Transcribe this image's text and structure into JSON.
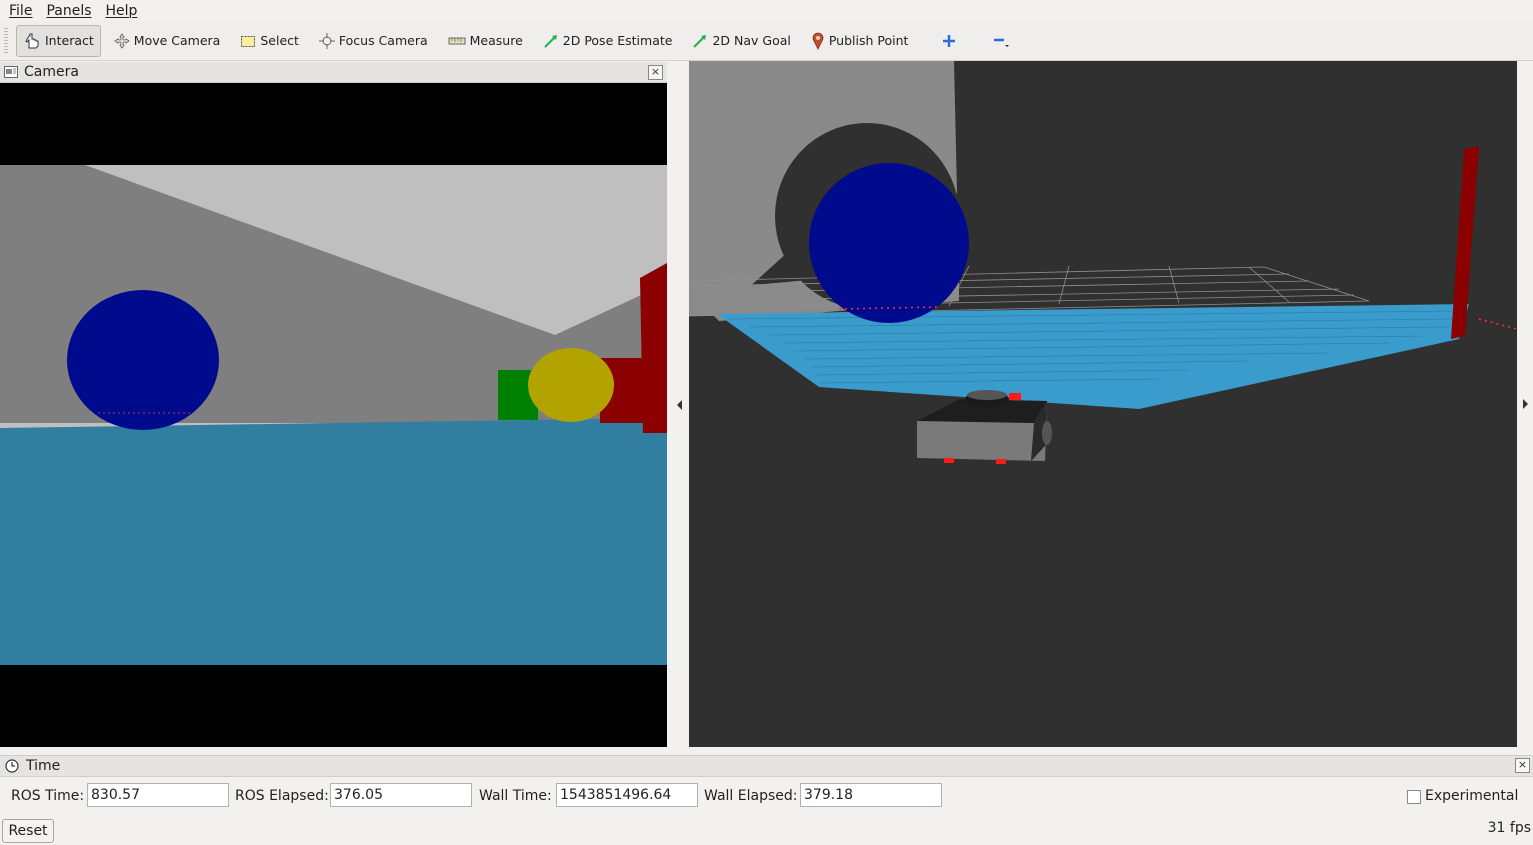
{
  "menu": {
    "file": "File",
    "panels": "Panels",
    "help": "Help"
  },
  "toolbar": {
    "tools": [
      {
        "label": "Interact",
        "icon": "hand-pointer-icon",
        "active": true
      },
      {
        "label": "Move Camera",
        "icon": "move-arrows-icon"
      },
      {
        "label": "Select",
        "icon": "selection-box-icon"
      },
      {
        "label": "Focus Camera",
        "icon": "focus-crosshair-icon"
      },
      {
        "label": "Measure",
        "icon": "ruler-icon"
      },
      {
        "label": "2D Pose Estimate",
        "icon": "green-arrow-icon"
      },
      {
        "label": "2D Nav Goal",
        "icon": "green-arrow-icon"
      },
      {
        "label": "Publish Point",
        "icon": "map-pin-icon"
      }
    ],
    "add_icon": "plus-icon",
    "remove_icon": "minus-dropdown-icon"
  },
  "camera_panel": {
    "title": "Camera"
  },
  "time_panel": {
    "title": "Time",
    "ros_time_label": "ROS Time:",
    "ros_time_value": "830.57",
    "ros_elapsed_label": "ROS Elapsed:",
    "ros_elapsed_value": "376.05",
    "wall_time_label": "Wall Time:",
    "wall_time_value": "1543851496.64",
    "wall_elapsed_label": "Wall Elapsed:",
    "wall_elapsed_value": "379.18",
    "experimental_label": "Experimental",
    "experimental_checked": false,
    "reset_label": "Reset",
    "fps": "31 fps"
  },
  "colors": {
    "sphere": "#000a8c",
    "floor_camera": "#317ea0",
    "pointcloud": "#3a9ccc",
    "wall_gray": "#7f7f7f",
    "wall_light": "#bfbfbf",
    "red_wall": "#8b0000",
    "green_box": "#008000",
    "yellow_ball": "#b2a300",
    "render_bg": "#303030"
  }
}
